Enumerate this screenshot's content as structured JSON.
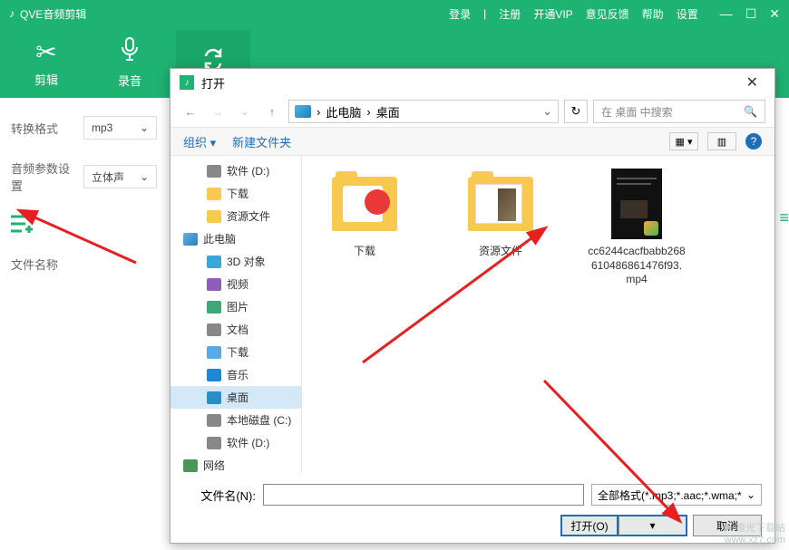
{
  "app": {
    "title": "QVE音频剪辑",
    "header_links": [
      "登录",
      "注册",
      "开通VIP",
      "意见反馈",
      "帮助",
      "设置"
    ],
    "separator": "|",
    "tools": [
      {
        "label": "剪辑"
      },
      {
        "label": "录音"
      }
    ],
    "sidebar": {
      "format_label": "转换格式",
      "format_value": "mp3",
      "params_label": "音频参数设置",
      "params_value": "立体声",
      "filename_label": "文件名称"
    }
  },
  "dialog": {
    "title": "打开",
    "breadcrumb": [
      "此电脑",
      "桌面"
    ],
    "breadcrumb_sep": "›",
    "search_placeholder": "在 桌面 中搜索",
    "toolbar": {
      "organize": "组织",
      "new_folder": "新建文件夹"
    },
    "tree": [
      {
        "label": "软件 (D:)",
        "icon": "drive",
        "level": 2
      },
      {
        "label": "下载",
        "icon": "folder",
        "level": 2
      },
      {
        "label": "资源文件",
        "icon": "folder",
        "level": 2
      },
      {
        "label": "此电脑",
        "icon": "pc",
        "level": 1,
        "header": true
      },
      {
        "label": "3D 对象",
        "icon": "3d",
        "level": 2
      },
      {
        "label": "视频",
        "icon": "video",
        "level": 2
      },
      {
        "label": "图片",
        "icon": "image",
        "level": 2
      },
      {
        "label": "文档",
        "icon": "doc",
        "level": 2
      },
      {
        "label": "下载",
        "icon": "down",
        "level": 2
      },
      {
        "label": "音乐",
        "icon": "music",
        "level": 2
      },
      {
        "label": "桌面",
        "icon": "desktop",
        "level": 2,
        "selected": true
      },
      {
        "label": "本地磁盘 (C:)",
        "icon": "drive",
        "level": 2
      },
      {
        "label": "软件 (D:)",
        "icon": "drive",
        "level": 2
      },
      {
        "label": "网络",
        "icon": "network",
        "level": 1,
        "header": true
      }
    ],
    "files": [
      {
        "name": "下载",
        "type": "folder1"
      },
      {
        "name": "资源文件",
        "type": "folder2"
      },
      {
        "name": "cc6244cacfbabb268610486861476f93.mp4",
        "type": "video"
      }
    ],
    "filename_label": "文件名(N):",
    "filename_value": "",
    "filter": "全部格式(*.mp3;*.aac;*.wma;*",
    "open_btn": "打开(O)",
    "cancel_btn": "取消"
  },
  "watermark": {
    "line1": "▶ 极光下载站",
    "line2": "www.xz7.com"
  }
}
